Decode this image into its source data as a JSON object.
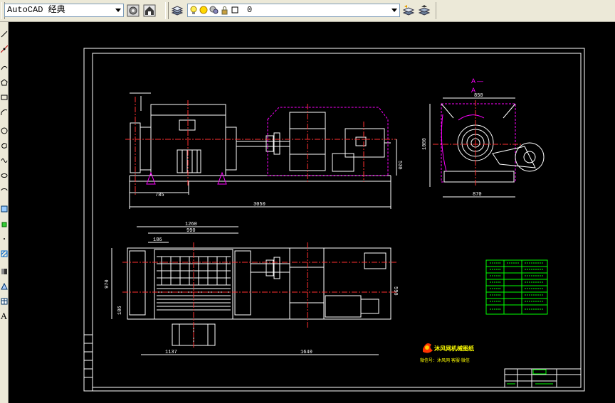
{
  "toolbar": {
    "workspace": "AutoCAD 经典",
    "layer": "0",
    "icons": [
      "workspace-settings-icon",
      "workspace-home-icon",
      "layer-manager-icon",
      "lightbulb-icon",
      "sun-icon",
      "freeze-icon",
      "lock-icon",
      "color-square-icon",
      "layer-previous-icon",
      "layer-states-icon"
    ]
  },
  "sidebar": {
    "tools": [
      "line-icon",
      "construction-line-icon",
      "polyline-icon",
      "polygon-icon",
      "rectangle-icon",
      "arc-icon",
      "circle-icon",
      "revision-cloud-icon",
      "spline-icon",
      "ellipse-icon",
      "ellipse-arc-icon",
      "insert-block-icon",
      "make-block-icon",
      "point-icon",
      "hatch-icon",
      "gradient-icon",
      "region-icon",
      "table-icon",
      "multiline-text-icon"
    ],
    "text_tool_glyph": "A"
  },
  "drawing": {
    "section_label_top": "A —",
    "section_label_bottom": "A",
    "dims": {
      "side_left_offset": "785",
      "side_total": "3050",
      "side_height": "530",
      "end_width": "850",
      "end_height": "1080",
      "end_base": "870",
      "plan_1260": "1260",
      "plan_990": "990",
      "plan_186": "186",
      "plan_left_height": "970",
      "plan_left_small": "186",
      "plan_right_height": "590",
      "plan_1137": "1137",
      "plan_1640": "1640"
    },
    "logo_text": "沐风网机械图纸",
    "logo_subtext": "微信号：沐风网 客服·微信"
  },
  "colors": {
    "canvas": "#000000",
    "outline": "#ffffff",
    "centerline": "#ff3030",
    "hidden": "#ff00ff",
    "table_green": "#00ff00",
    "logo": "#ffff00"
  }
}
